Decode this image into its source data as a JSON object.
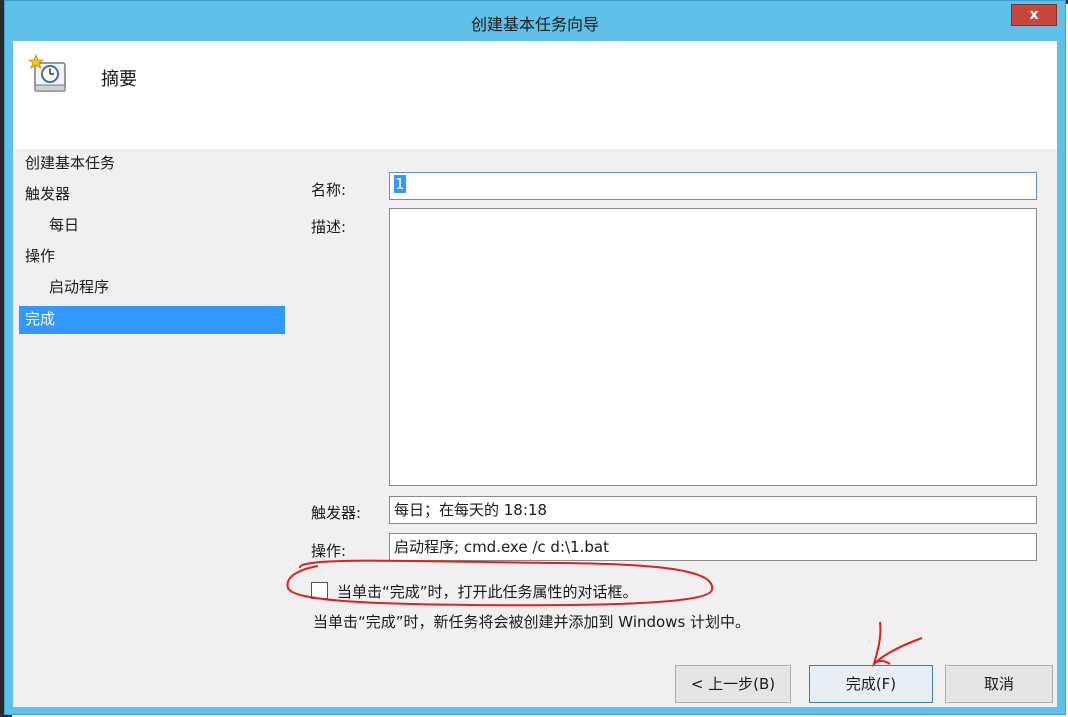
{
  "window": {
    "title": "创建基本任务向导",
    "close_label": "x"
  },
  "header": {
    "title": "摘要",
    "icon": "task-clock-icon"
  },
  "steps": [
    {
      "label": "创建基本任务",
      "level": 0,
      "active": false
    },
    {
      "label": "触发器",
      "level": 0,
      "active": false
    },
    {
      "label": "每日",
      "level": 1,
      "active": false
    },
    {
      "label": "操作",
      "level": 0,
      "active": false
    },
    {
      "label": "启动程序",
      "level": 1,
      "active": false
    },
    {
      "label": "完成",
      "level": 0,
      "active": true
    }
  ],
  "form": {
    "name_label": "名称:",
    "name_value": "1",
    "desc_label": "描述:",
    "desc_value": "",
    "trigger_label": "触发器:",
    "trigger_value": "每日；在每天的 18:18",
    "action_label": "操作:",
    "action_value": "启动程序; cmd.exe /c d:\\1.bat"
  },
  "open_props": {
    "label": "当单击“完成”时，打开此任务属性的对话框。",
    "checked": false
  },
  "note": "当单击“完成”时，新任务将会被创建并添加到 Windows 计划中。",
  "buttons": {
    "back": "< 上一步(B)",
    "finish": "完成(F)",
    "cancel": "取消"
  },
  "colors": {
    "titlebar": "#5fc0ea",
    "selection": "#3399ff",
    "close": "#c9463d",
    "annotation": "#e0201a"
  }
}
